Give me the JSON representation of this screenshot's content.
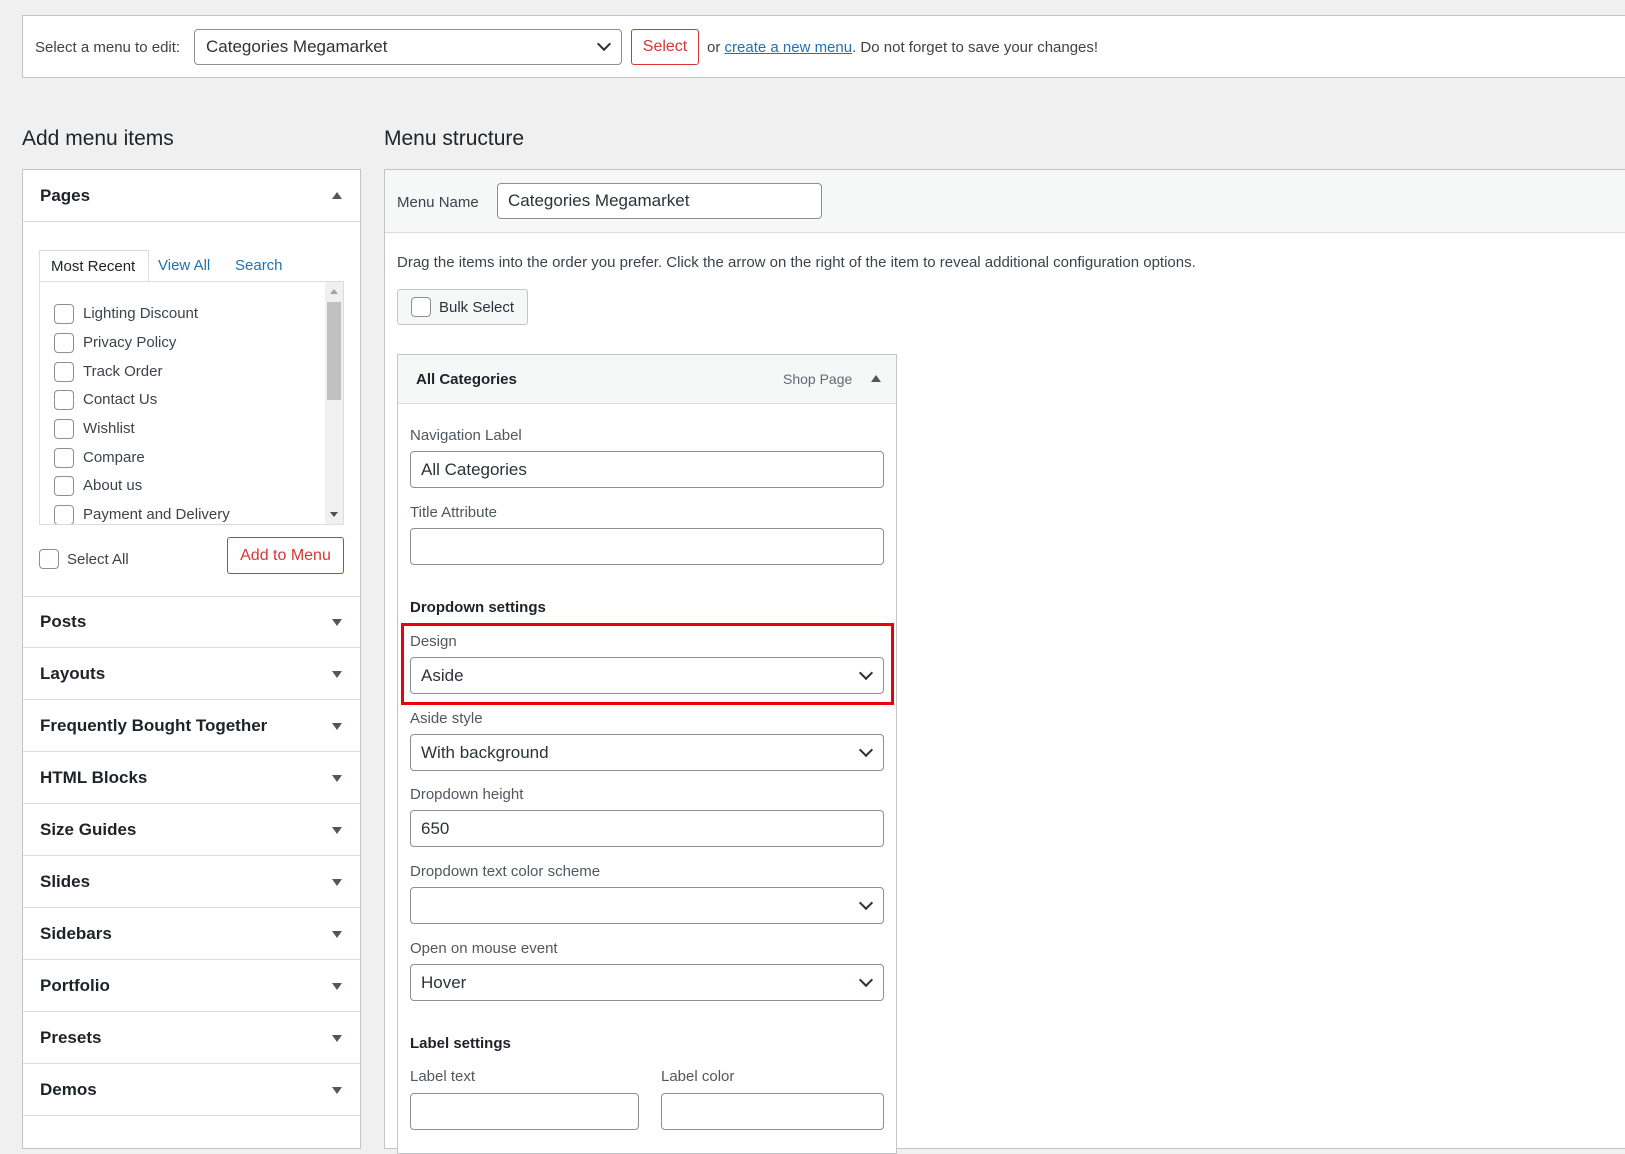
{
  "top_bar": {
    "select_label": "Select a menu to edit:",
    "menu_select_value": "Categories Megamarket",
    "select_button": "Select",
    "or_text": "or",
    "create_link": "create a new menu",
    "save_note": ". Do not forget to save your changes!"
  },
  "left": {
    "heading": "Add menu items",
    "pages": {
      "title": "Pages",
      "tabs": [
        "Most Recent",
        "View All",
        "Search"
      ],
      "items": [
        "Lighting Discount",
        "Privacy Policy",
        "Track Order",
        "Contact Us",
        "Wishlist",
        "Compare",
        "About us",
        "Payment and Delivery"
      ],
      "select_all": "Select All",
      "add_button": "Add to Menu"
    },
    "sections": [
      "Posts",
      "Layouts",
      "Frequently Bought Together",
      "HTML Blocks",
      "Size Guides",
      "Slides",
      "Sidebars",
      "Portfolio",
      "Presets",
      "Demos"
    ]
  },
  "right": {
    "heading": "Menu structure",
    "menu_name_label": "Menu Name",
    "menu_name_value": "Categories Megamarket",
    "instructions": "Drag the items into the order you prefer. Click the arrow on the right of the item to reveal additional configuration options.",
    "bulk_select": "Bulk Select",
    "item": {
      "title": "All Categories",
      "type": "Shop Page",
      "nav_label_label": "Navigation Label",
      "nav_label_value": "All Categories",
      "title_attr_label": "Title Attribute",
      "title_attr_value": "",
      "dropdown_settings": "Dropdown settings",
      "design_label": "Design",
      "design_value": "Aside",
      "aside_style_label": "Aside style",
      "aside_style_value": "With background",
      "dropdown_height_label": "Dropdown height",
      "dropdown_height_value": "650",
      "text_color_label": "Dropdown text color scheme",
      "text_color_value": "",
      "mouse_event_label": "Open on mouse event",
      "mouse_event_value": "Hover",
      "label_settings": "Label settings",
      "label_text_label": "Label text",
      "label_color_label": "Label color"
    }
  },
  "colors": {
    "link": "#2271b1",
    "danger": "#d63638",
    "highlight": "#e8000b"
  }
}
